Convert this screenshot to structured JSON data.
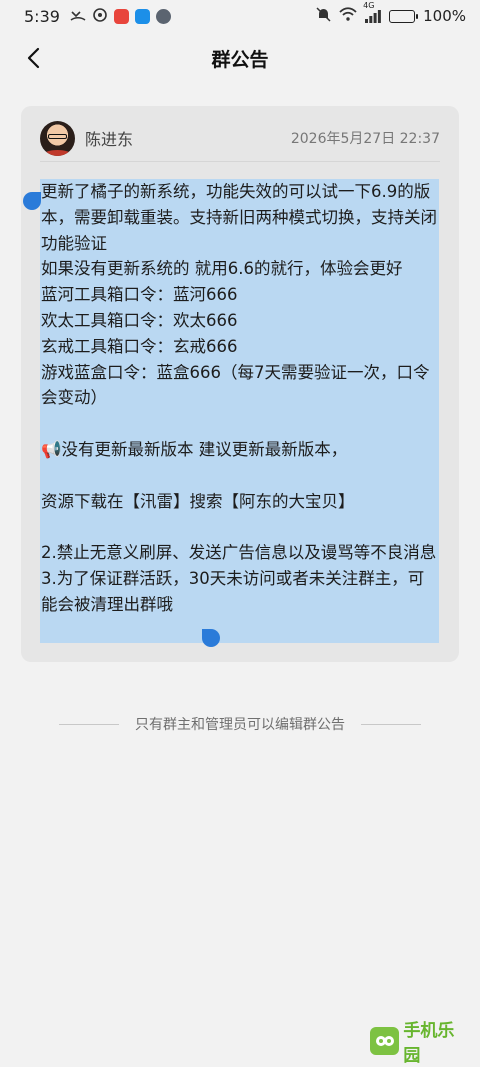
{
  "status_bar": {
    "time": "5:39",
    "battery_text": "100%",
    "signal_label": "4G",
    "icons": [
      "missed-call-icon",
      "wifi-icon",
      "app-red-icon",
      "cloud-icon",
      "browser-icon",
      "mute-icon",
      "signal-icon",
      "battery-icon"
    ]
  },
  "nav": {
    "title": "群公告",
    "back_icon": "chevron-left-icon"
  },
  "post": {
    "author": "陈进东",
    "time": "2026年5月27日 22:37",
    "body": "更新了橘子的新系统，功能失效的可以试一下6.9的版本，需要卸载重装。支持新旧两种模式切换，支持关闭功能验证\n如果没有更新系统的 就用6.6的就行，体验会更好\n蓝河工具箱口令：蓝河666\n欢太工具箱口令：欢太666\n玄戒工具箱口令：玄戒666\n游戏蓝盒口令：蓝盒666（每7天需要验证一次，口令会变动）\n\n📢没有更新最新版本 建议更新最新版本，\n\n资源下载在【汛雷】搜索【阿东的大宝贝】\n\n2.禁止无意义刷屏、发送广告信息以及谩骂等不良消息\n3.为了保证群活跃，30天未访问或者未关注群主，可能会被清理出群哦",
    "selection_color": "#bad8f2",
    "handle_color": "#2b7bd9"
  },
  "footer": {
    "note": "只有群主和管理员可以编辑群公告"
  },
  "watermark": {
    "text": "手机乐园"
  }
}
